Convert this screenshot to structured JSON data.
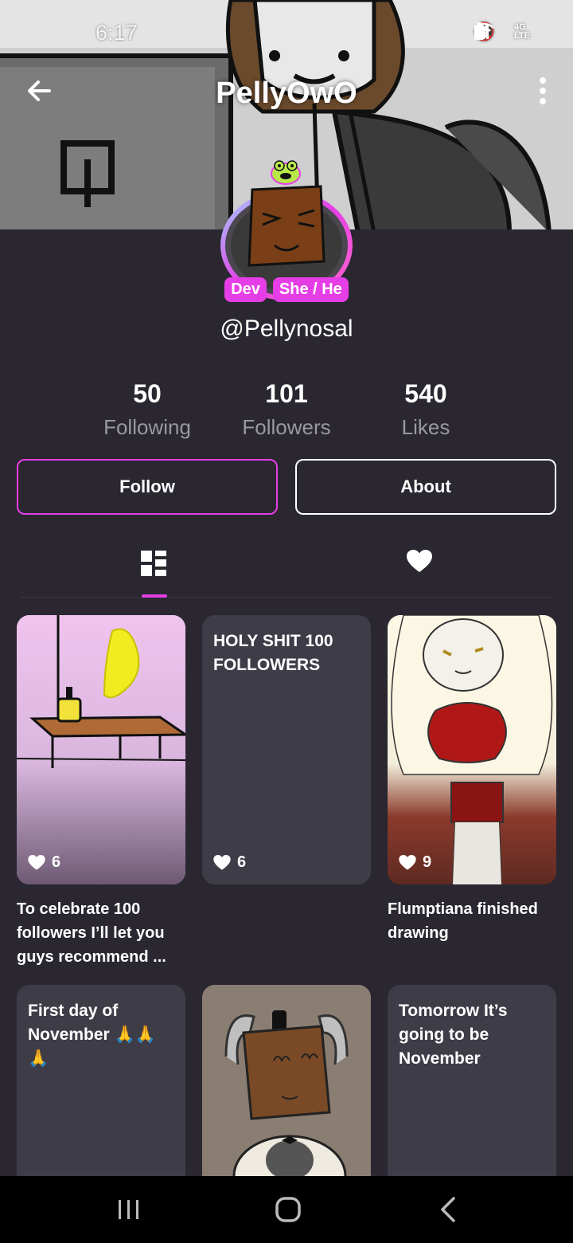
{
  "status_bar": {
    "time": "6:17",
    "icons": [
      "mute-icon",
      "wifi-icon",
      "lte-icon",
      "signal-icon",
      "battery-icon"
    ]
  },
  "header": {
    "title": "PellyOwO",
    "back_icon": "arrow-left-icon",
    "more_icon": "more-vertical-icon"
  },
  "profile": {
    "tags": [
      "Dev",
      "She / He"
    ],
    "handle": "@Pellynosal",
    "stats": [
      {
        "value": "50",
        "label": "Following"
      },
      {
        "value": "101",
        "label": "Followers"
      },
      {
        "value": "540",
        "label": "Likes"
      }
    ]
  },
  "actions": {
    "follow_label": "Follow",
    "about_label": "About"
  },
  "tabs": {
    "items": [
      {
        "icon": "grid-icon",
        "active": true
      },
      {
        "icon": "heart-icon",
        "active": false
      }
    ]
  },
  "posts": [
    {
      "type": "image",
      "likes": "6",
      "caption": "To celebrate 100 followers I’ll let you guys recommend ..."
    },
    {
      "type": "text",
      "text": "HOLY SHIT 100 FOLLOWERS",
      "likes": "6",
      "caption": ""
    },
    {
      "type": "image",
      "likes": "9",
      "caption": "Flumptiana finished drawing"
    },
    {
      "type": "text",
      "text": "First day of November 🙏🙏🙏"
    },
    {
      "type": "image"
    },
    {
      "type": "text",
      "text": "Tomorrow It’s going to be November"
    }
  ],
  "colors": {
    "background": "#2a2731",
    "accent": "#e63ee6",
    "card": "#3e3c47",
    "muted_text": "#9a98a0"
  },
  "navigation": {
    "icons": [
      "recents-icon",
      "home-icon",
      "back-icon"
    ]
  }
}
